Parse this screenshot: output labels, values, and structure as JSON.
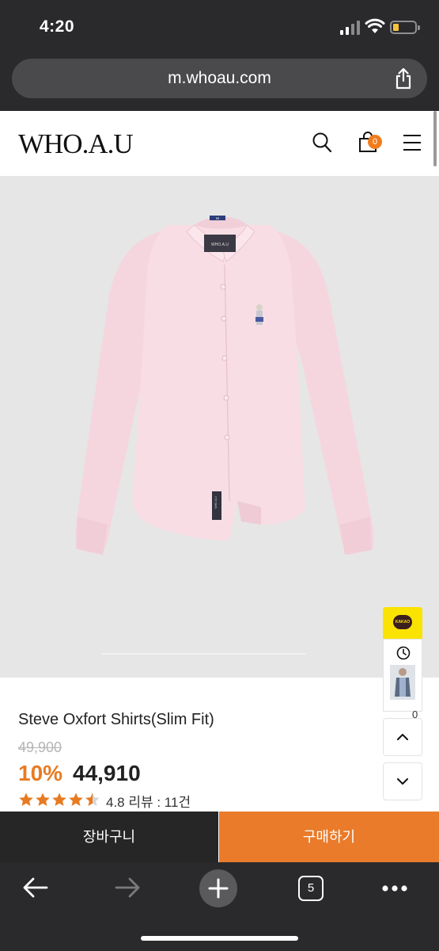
{
  "status_bar": {
    "time": "4:20"
  },
  "browser": {
    "url": "m.whoau.com",
    "open_tabs": "5"
  },
  "site": {
    "logo": "WHO.A.U",
    "cart_count": "0"
  },
  "shirt_labels": {
    "collar_tag": "WHO.A.U",
    "size_tag": "M",
    "brand_patch": "WHO.A.U"
  },
  "floating": {
    "kakao_label": "KAKAO",
    "recent_count": "0"
  },
  "product": {
    "name": "Steve Oxfort Shirts(Slim Fit)",
    "original_price": "49,900",
    "discount": "10%",
    "price": "44,910",
    "rating_value": 4.8,
    "rating_text": "4.8 리뷰 : 11건"
  },
  "actions": {
    "cart": "장바구니",
    "buy": "구매하기"
  },
  "colors": {
    "accent": "#e97b2a",
    "dark": "#262626",
    "kakao": "#fae300",
    "shirt": "#f6dbe3"
  }
}
